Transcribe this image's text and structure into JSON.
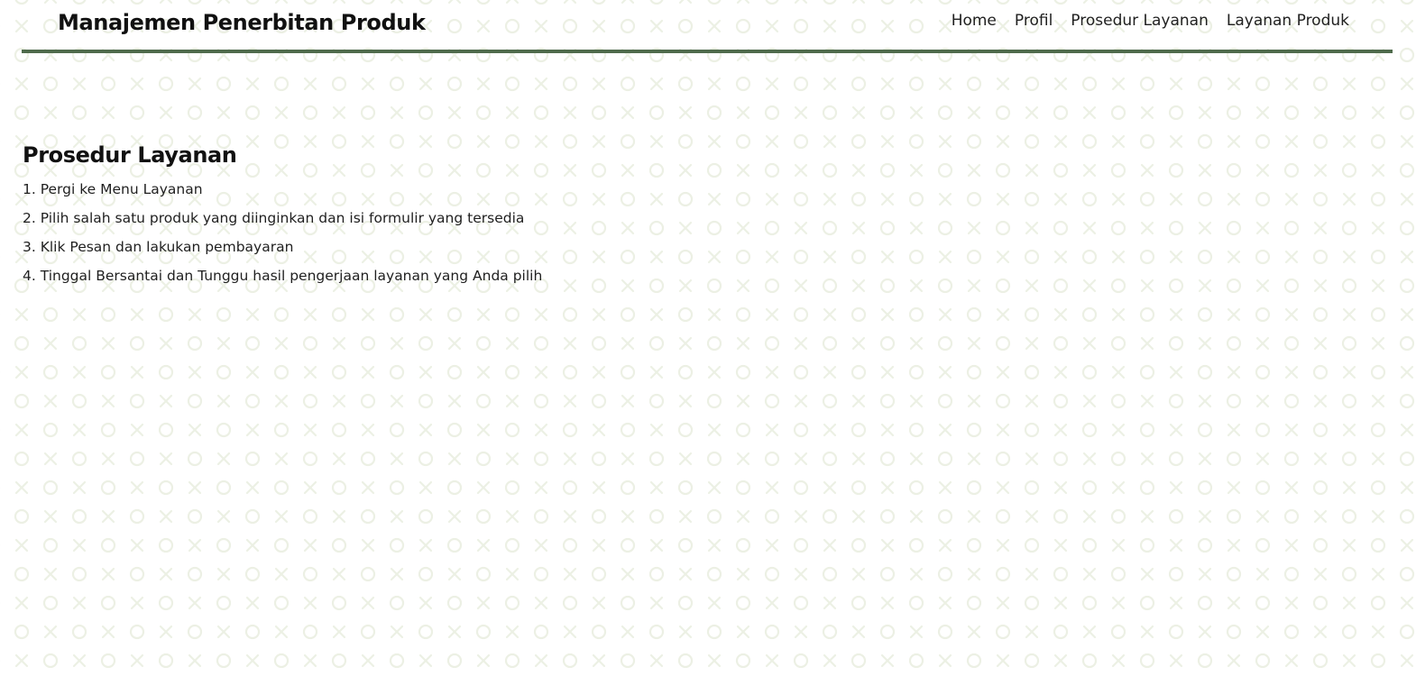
{
  "header": {
    "brand": "Manajemen Penerbitan Produk",
    "nav": [
      {
        "label": "Home"
      },
      {
        "label": "Profil"
      },
      {
        "label": "Prosedur Layanan"
      },
      {
        "label": "Layanan Produk"
      }
    ]
  },
  "main": {
    "title": "Prosedur Layanan",
    "steps": [
      "1. Pergi ke Menu Layanan",
      "2. Pilih salah satu produk yang diinginkan dan isi formulir yang tersedia",
      "3. Klik Pesan dan lakukan pembayaran",
      "4. Tinggal Bersantai dan Tunggu hasil pengerjaan layanan yang Anda pilih"
    ]
  },
  "theme": {
    "accent_color": "#4f6b4c",
    "pattern_color": "#ecf0e4",
    "background_pattern": "circle-x-icon"
  }
}
